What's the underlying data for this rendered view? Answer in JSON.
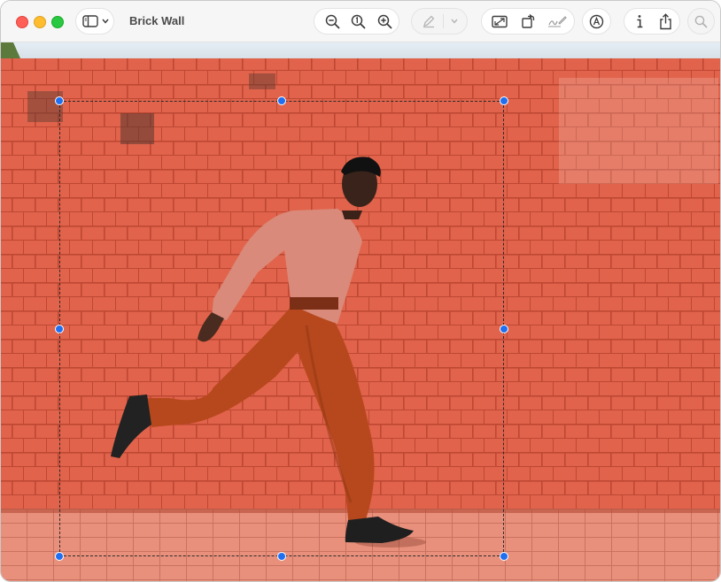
{
  "window": {
    "title": "Brick Wall"
  },
  "toolbar": {
    "sidebar_button": "sidebar-toggle-icon",
    "zoom_out": "zoom-out-icon",
    "actual_size": "actual-size-icon",
    "zoom_in": "zoom-in-icon",
    "markup_pen": "pen-icon",
    "markup_menu": "chevron-down-icon",
    "adjust_size": "crop-icon",
    "rotate": "rotate-icon",
    "signature": "signature-icon",
    "markup_toggle": "markup-icon",
    "info": "info-icon",
    "share": "share-icon",
    "search": "search-icon"
  },
  "colors": {
    "accent": "#1f6ff2",
    "brick": "#e0614a",
    "pavement": "#e8907c",
    "shirt": "#d98a7a",
    "trousers": "#b7481d"
  }
}
